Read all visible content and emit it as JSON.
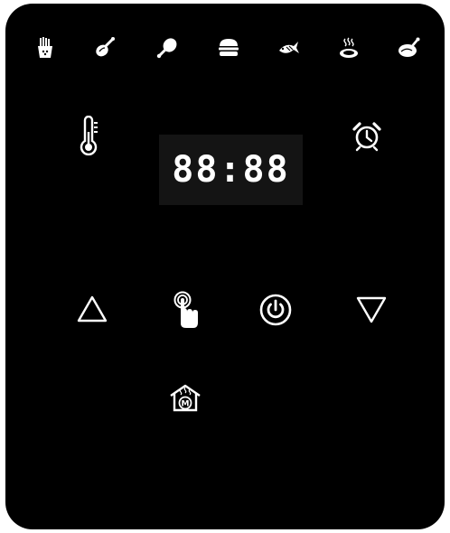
{
  "display": {
    "time": "88:88"
  },
  "presets": [
    {
      "name": "fries-icon"
    },
    {
      "name": "drumstick-meat-icon"
    },
    {
      "name": "chicken-leg-icon"
    },
    {
      "name": "burger-icon"
    },
    {
      "name": "fish-icon"
    },
    {
      "name": "steak-icon"
    },
    {
      "name": "roast-chicken-icon"
    }
  ],
  "controls": {
    "temperature": "thermometer-icon",
    "timer": "alarm-clock-icon",
    "up": "up-triangle-icon",
    "touch": "touch-hand-icon",
    "power": "power-icon",
    "down": "down-triangle-icon",
    "menu": "menu-house-icon",
    "menu_badge": "M"
  },
  "colors": {
    "panel": "#000000",
    "display_bg": "#141414",
    "glyph": "#ffffff"
  }
}
